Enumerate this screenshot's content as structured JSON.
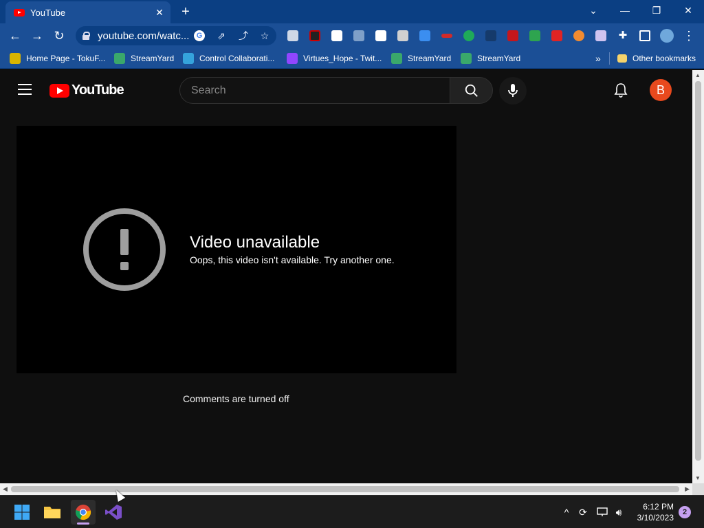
{
  "browser": {
    "tab": {
      "title": "YouTube",
      "close_glyph": "✕"
    },
    "new_tab_glyph": "+",
    "window_controls": {
      "tab_search": "⌄",
      "minimize": "—",
      "restore": "❐",
      "close": "✕"
    },
    "toolbar": {
      "back": "←",
      "forward": "→",
      "reload": "↻",
      "url": "youtube.com/watc...",
      "menu": "⋮"
    },
    "bookmarks": [
      {
        "label": "Home Page - TokuF...",
        "color": "#d9b400"
      },
      {
        "label": "StreamYard",
        "color": "#3aa86b"
      },
      {
        "label": "Control Collaborati...",
        "color": "#35a3dc"
      },
      {
        "label": "Virtues_Hope - Twit...",
        "color": "#9146ff"
      },
      {
        "label": "StreamYard",
        "color": "#3aa86b"
      },
      {
        "label": "StreamYard",
        "color": "#3aa86b"
      }
    ],
    "bookmarks_overflow": "»",
    "other_bookmarks": "Other bookmarks"
  },
  "youtube": {
    "logo_text": "YouTube",
    "search_placeholder": "Search",
    "avatar_letter": "B",
    "player": {
      "error_title": "Video unavailable",
      "error_subtitle": "Oops, this video isn't available. Try another one."
    },
    "comments_status": "Comments are turned off"
  },
  "taskbar": {
    "time": "6:12 PM",
    "date": "3/10/2023",
    "notification_count": "2",
    "tray_chevron": "^"
  },
  "colors": {
    "brand_red": "#ff0000",
    "avatar_bg": "#e8491d",
    "chrome_frame": "#0b3f83",
    "chrome_toolbar": "#1b4f96",
    "yt_background": "#0f0f0f"
  }
}
